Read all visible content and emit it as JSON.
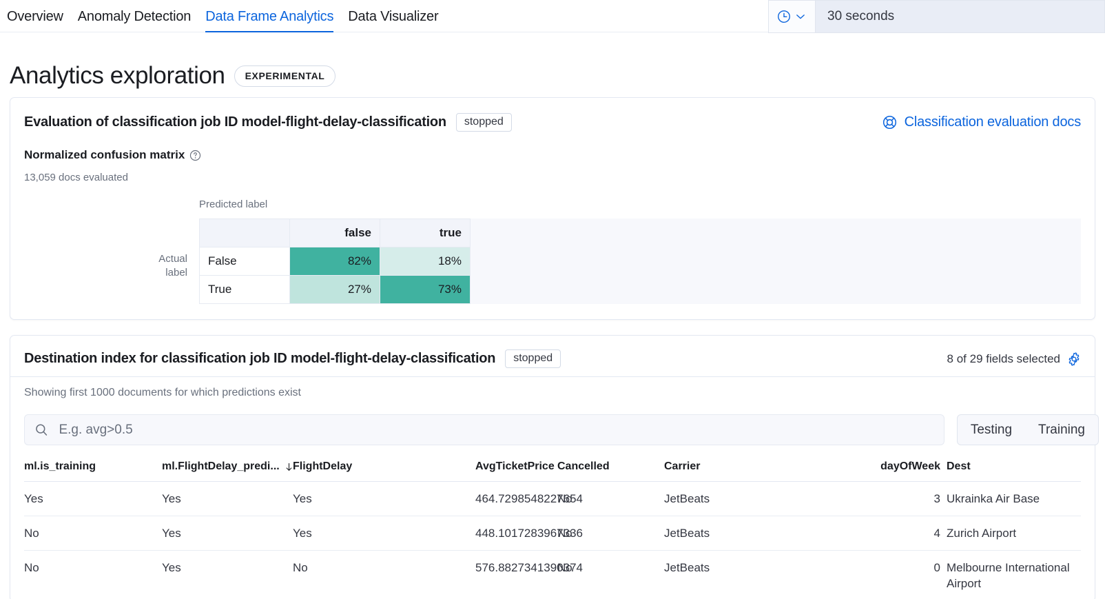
{
  "nav": {
    "tabs": [
      {
        "label": "Overview",
        "active": false
      },
      {
        "label": "Anomaly Detection",
        "active": false
      },
      {
        "label": "Data Frame Analytics",
        "active": true
      },
      {
        "label": "Data Visualizer",
        "active": false
      }
    ]
  },
  "timepicker": {
    "clock_icon": "clock-icon",
    "chevron_icon": "chevron-down-icon",
    "refresh_interval": "30 seconds"
  },
  "header": {
    "title": "Analytics exploration",
    "badge": "EXPERIMENTAL"
  },
  "evaluation": {
    "title": "Evaluation of classification job ID model-flight-delay-classification",
    "status": "stopped",
    "docs_link": "Classification evaluation docs",
    "docs_link_icon": "help-buoy-icon",
    "section_title": "Normalized confusion matrix",
    "section_help_icon": "question-in-circle-icon",
    "docs_evaluated": "13,059 docs evaluated"
  },
  "chart_data": {
    "type": "heatmap",
    "title": "Normalized confusion matrix",
    "xlabel": "Predicted label",
    "ylabel": "Actual label",
    "x_tick_labels": [
      "false",
      "true"
    ],
    "y_tick_labels": [
      "False",
      "True"
    ],
    "rows": [
      {
        "actual": "False",
        "cells": [
          {
            "predicted": "false",
            "value": "82%",
            "num": 82,
            "color": "#40B2A0"
          },
          {
            "predicted": "true",
            "value": "18%",
            "num": 18,
            "color": "#D6EDEA"
          }
        ]
      },
      {
        "actual": "True",
        "cells": [
          {
            "predicted": "false",
            "value": "27%",
            "num": 27,
            "color": "#BFE4DD"
          },
          {
            "predicted": "true",
            "value": "73%",
            "num": 73,
            "color": "#40B2A0"
          }
        ]
      }
    ],
    "colors": {
      "high": "#40B2A0",
      "mid": "#BFE4DD",
      "low": "#D6EDEA"
    },
    "legend": "none",
    "grid": true
  },
  "destination": {
    "title": "Destination index for classification job ID model-flight-delay-classification",
    "status": "stopped",
    "fields_selected": "8 of 29 fields selected",
    "gear_icon": "gear-icon",
    "subtitle": "Showing first 1000 documents for which predictions exist",
    "search": {
      "icon": "search-icon",
      "placeholder": "E.g. avg>0.5",
      "value": ""
    },
    "buttons": [
      {
        "label": "Testing"
      },
      {
        "label": "Training"
      }
    ],
    "table": {
      "columns": [
        {
          "label": "ml.is_training",
          "align": "left",
          "sorted": false,
          "cls": "c-istrain"
        },
        {
          "label": "ml.FlightDelay_predi...",
          "align": "left",
          "sorted": true,
          "sort_icon": "sort-down-icon",
          "cls": "c-pred"
        },
        {
          "label": "FlightDelay",
          "align": "left",
          "sorted": false,
          "cls": "c-delay"
        },
        {
          "label": "AvgTicketPrice",
          "align": "right",
          "sorted": false,
          "cls": "c-price"
        },
        {
          "label": "Cancelled",
          "align": "left",
          "sorted": false,
          "cls": "c-cancel"
        },
        {
          "label": "Carrier",
          "align": "left",
          "sorted": false,
          "cls": "c-carrier"
        },
        {
          "label": "dayOfWeek",
          "align": "right",
          "sorted": false,
          "cls": "c-dow"
        },
        {
          "label": "Dest",
          "align": "left",
          "sorted": false,
          "cls": "c-dest"
        }
      ],
      "rows": [
        [
          "Yes",
          "Yes",
          "Yes",
          "464.7298548227654",
          "No",
          "JetBeats",
          "3",
          "Ukrainka Air Base"
        ],
        [
          "No",
          "Yes",
          "Yes",
          "448.1017283967336",
          "No",
          "JetBeats",
          "4",
          "Zurich Airport"
        ],
        [
          "No",
          "Yes",
          "No",
          "576.8827341390374",
          "No",
          "JetBeats",
          "0",
          "Melbourne International Airport"
        ]
      ]
    }
  }
}
